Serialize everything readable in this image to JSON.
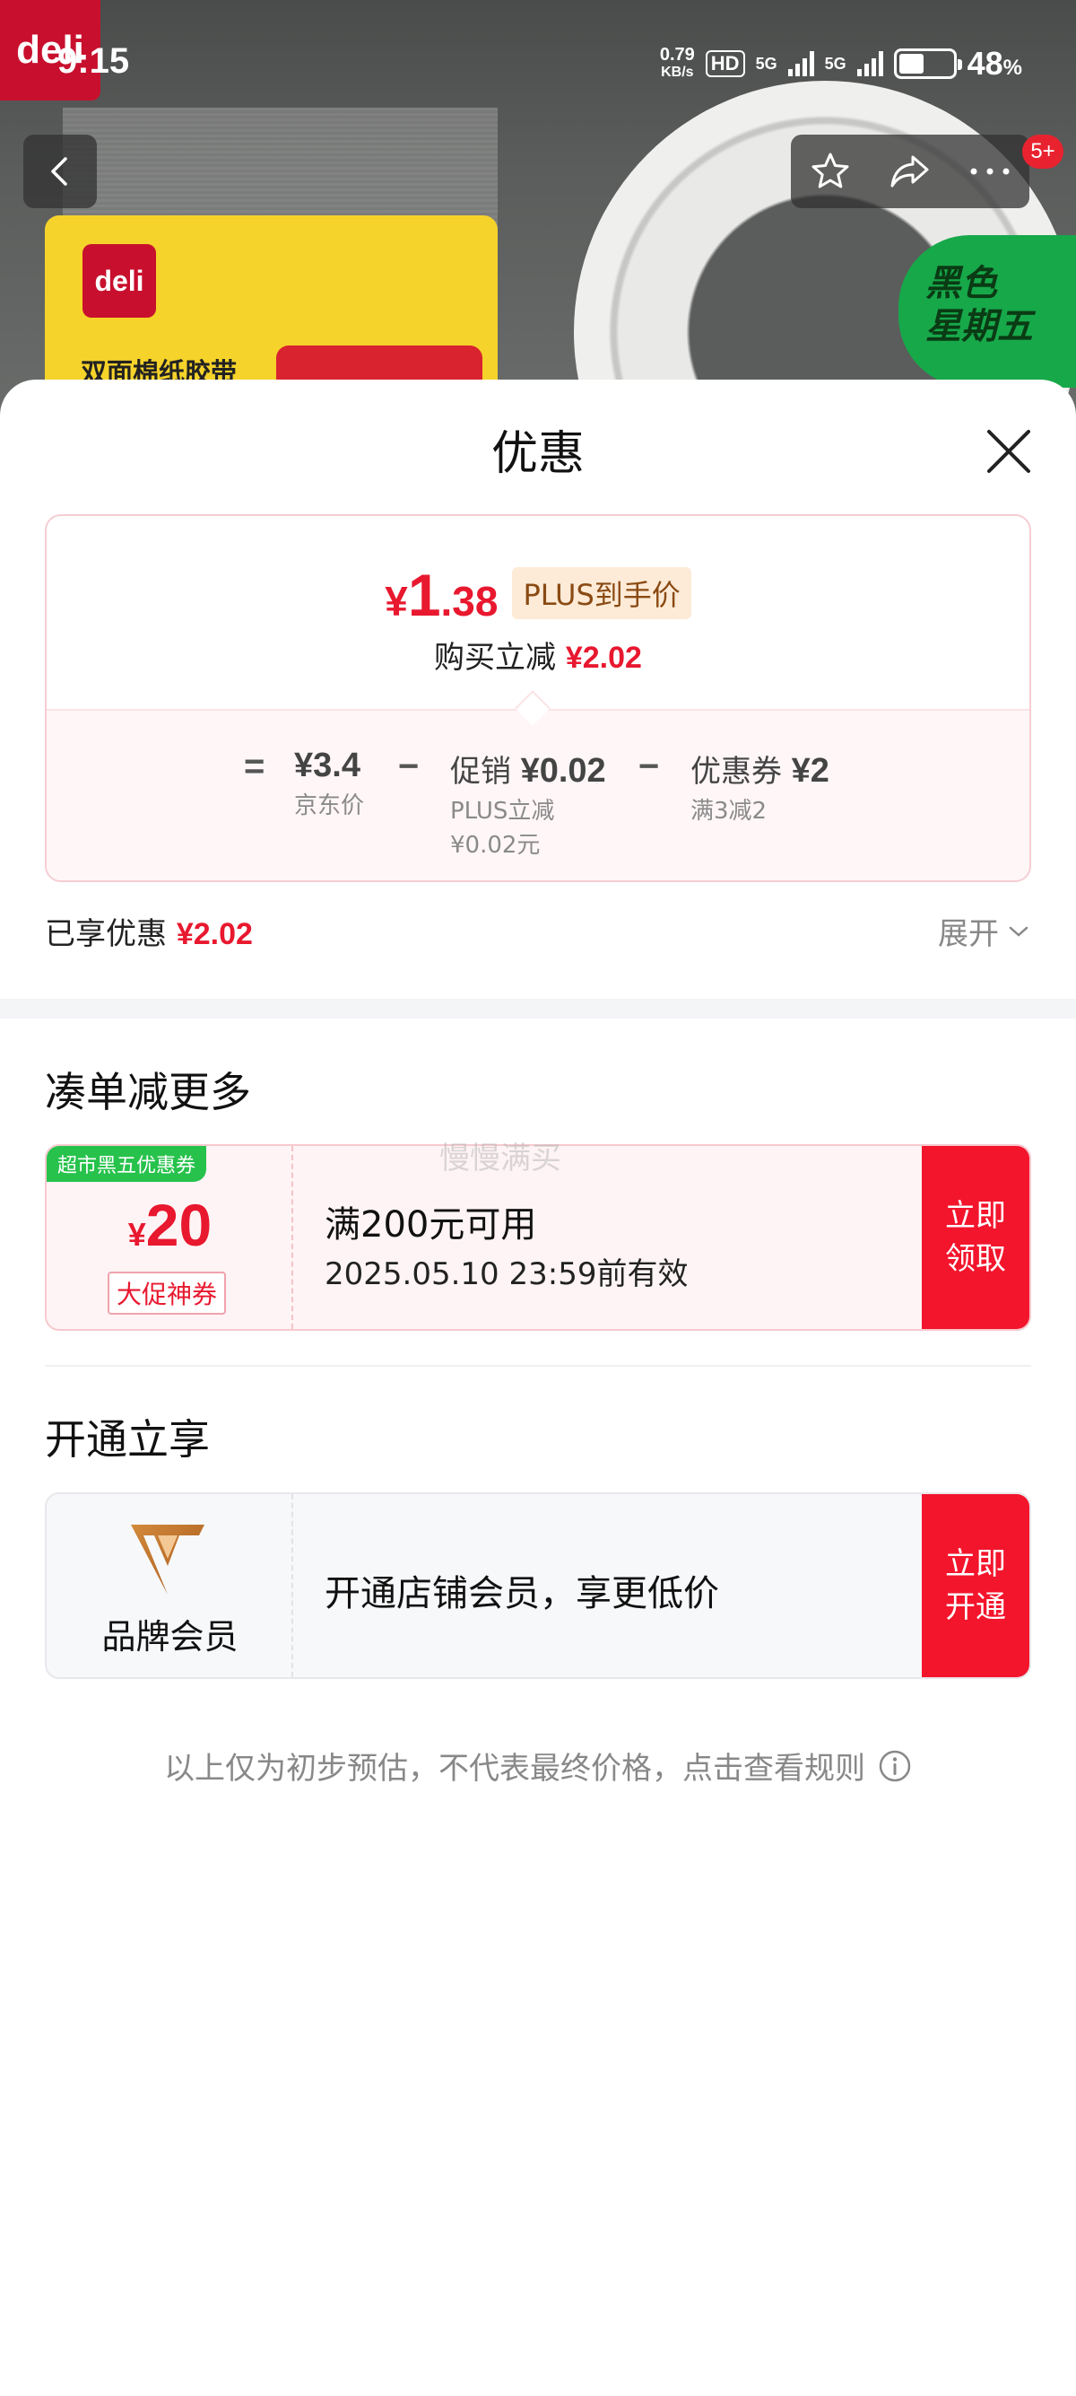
{
  "status_bar": {
    "time": "9:15",
    "net_speed_value": "0.79",
    "net_speed_unit": "KB/s",
    "hd": "HD",
    "network1": "5G",
    "network2": "5G",
    "battery_percent": "48",
    "battery_unit": "%",
    "battery_level": 0.48
  },
  "product_image": {
    "brand_logo": "deli",
    "package_text": "双面棉纸胶带",
    "promo_badge": "黑色\n星期五"
  },
  "nav": {
    "message_badge": "5+"
  },
  "sheet": {
    "title": "优惠",
    "summary": {
      "currency": "¥",
      "price_int": "1",
      "price_dec": ".38",
      "plus_tag": "PLUS到手价",
      "instant_label": "购买立减",
      "instant_amount": "¥2.02",
      "eq_sign": "=",
      "minus_sign": "−",
      "jd_price": "¥3.4",
      "jd_price_label": "京东价",
      "promo_label": "促销",
      "promo_value": "¥0.02",
      "promo_sub1": "PLUS立减",
      "promo_sub2": "¥0.02元",
      "coupon_label": "优惠券",
      "coupon_value": "¥2",
      "coupon_sub": "满3减2"
    },
    "enjoyed_label": "已享优惠",
    "enjoyed_amount": "¥2.02",
    "expand_label": "展开",
    "section_more": "凑单减更多",
    "coupon": {
      "tag": "超市黑五优惠券",
      "currency": "¥",
      "amount": "20",
      "kind": "大促神券",
      "condition": "满200元可用",
      "expiry": "2025.05.10 23:59前有效",
      "action": "立即领取"
    },
    "watermark": "慢慢满买",
    "section_join": "开通立享",
    "member": {
      "label": "品牌会员",
      "text": "开通店铺会员，享更低价",
      "action": "立即开通"
    },
    "disclaimer": "以上仅为初步预估，不代表最终价格，点击查看规则"
  },
  "colors": {
    "accent_red": "#e8182f",
    "button_red": "#f3152c",
    "coupon_tag_green": "#27c24c",
    "plus_tag_bg": "#fdebd7"
  },
  "icons": [
    "back-arrow-icon",
    "star-icon",
    "share-icon",
    "more-icon",
    "close-icon",
    "chevron-down-icon",
    "info-icon",
    "brand-member-logo-icon"
  ]
}
